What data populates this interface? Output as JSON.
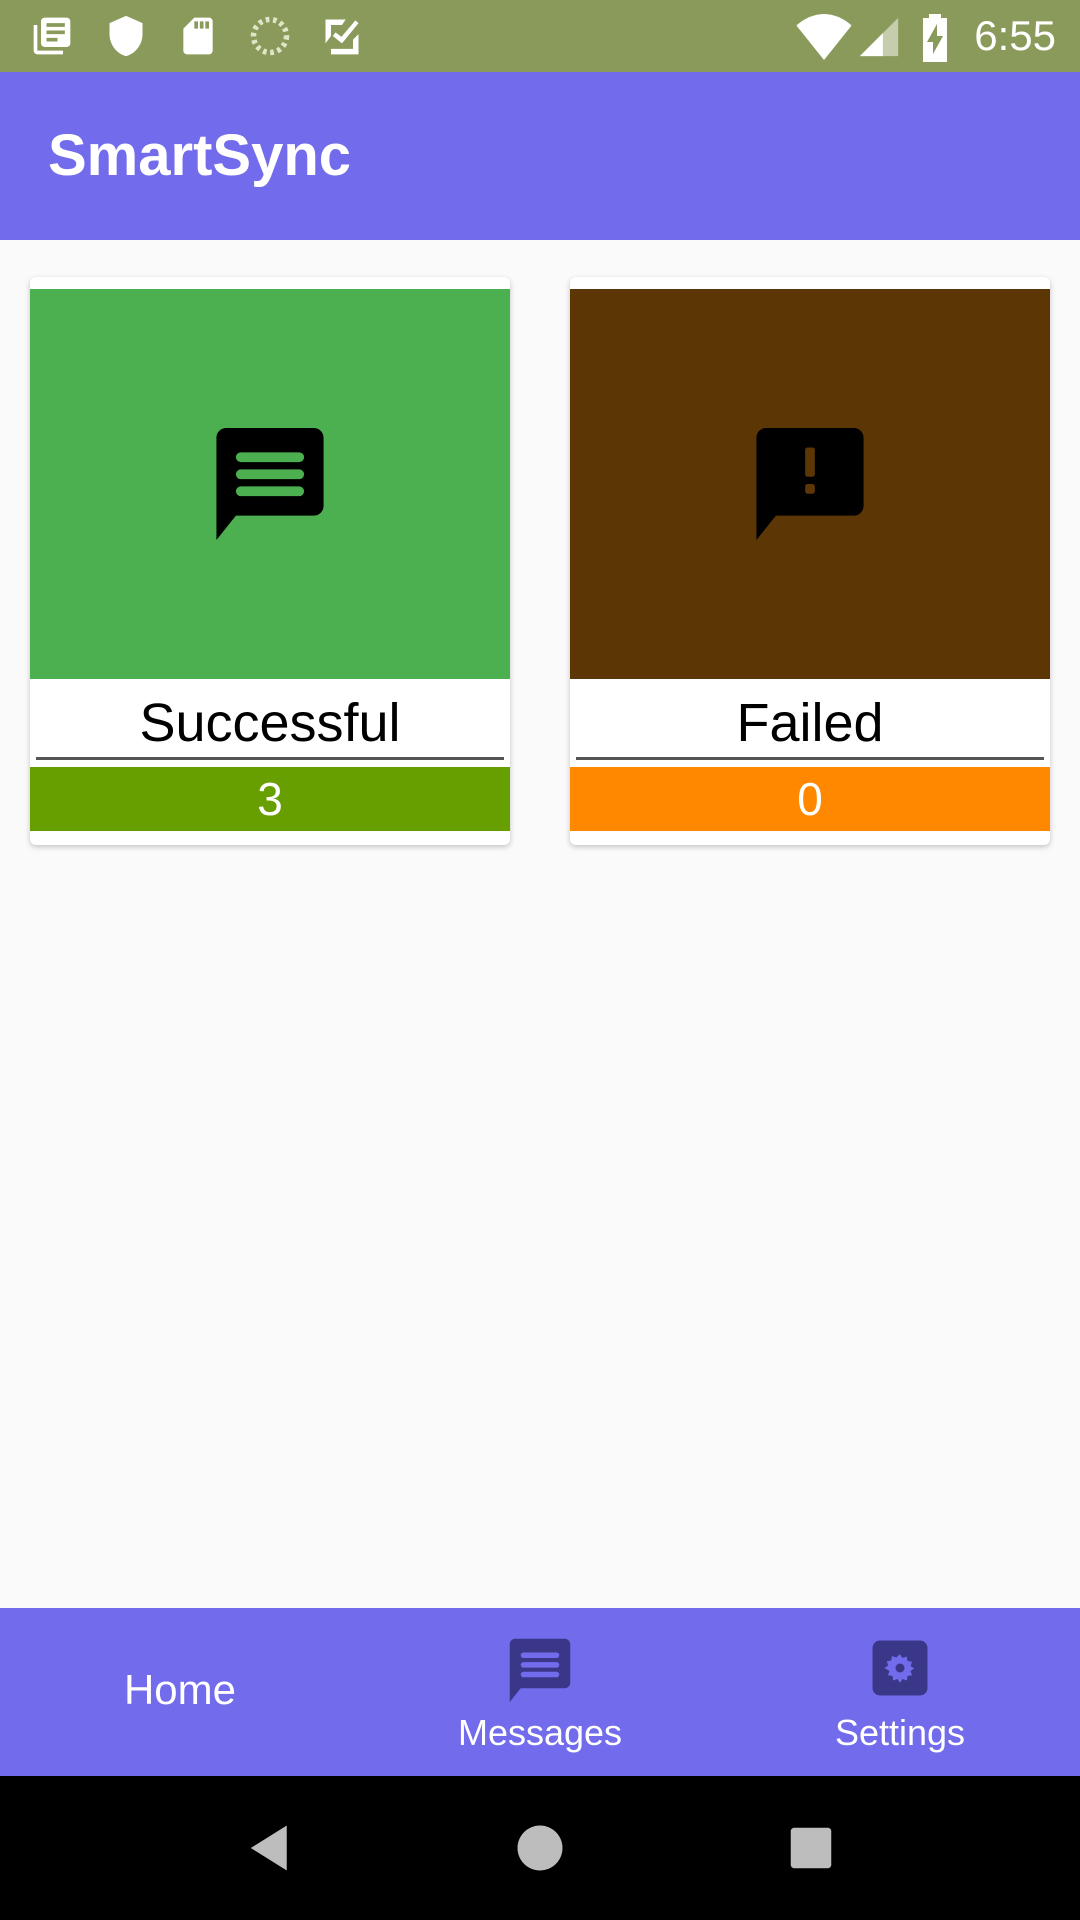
{
  "status_bar": {
    "time": "6:55",
    "left_icons": [
      "news-icon",
      "shield-icon",
      "sd-card-icon",
      "sync-spinner-icon",
      "task-check-icon"
    ],
    "right_icons": [
      "wifi-icon",
      "signal-icon",
      "battery-charging-icon"
    ],
    "background": "#8a9a5b"
  },
  "app_bar": {
    "title": "SmartSync",
    "background": "#726cec"
  },
  "cards": [
    {
      "label": "Successful",
      "count": "3",
      "icon": "message-icon",
      "image_color": "#4caf50",
      "count_color": "#689f00"
    },
    {
      "label": "Failed",
      "count": "0",
      "icon": "message-alert-icon",
      "image_color": "#5d3605",
      "count_color": "#ff8800"
    }
  ],
  "bottom_nav": {
    "background": "#726cec",
    "items": [
      {
        "label": "Home",
        "icon": ""
      },
      {
        "label": "Messages",
        "icon": "message-icon"
      },
      {
        "label": "Settings",
        "icon": "gear-icon"
      }
    ]
  },
  "system_nav": {
    "buttons": [
      "back-icon",
      "home-circle-icon",
      "recents-square-icon"
    ]
  }
}
